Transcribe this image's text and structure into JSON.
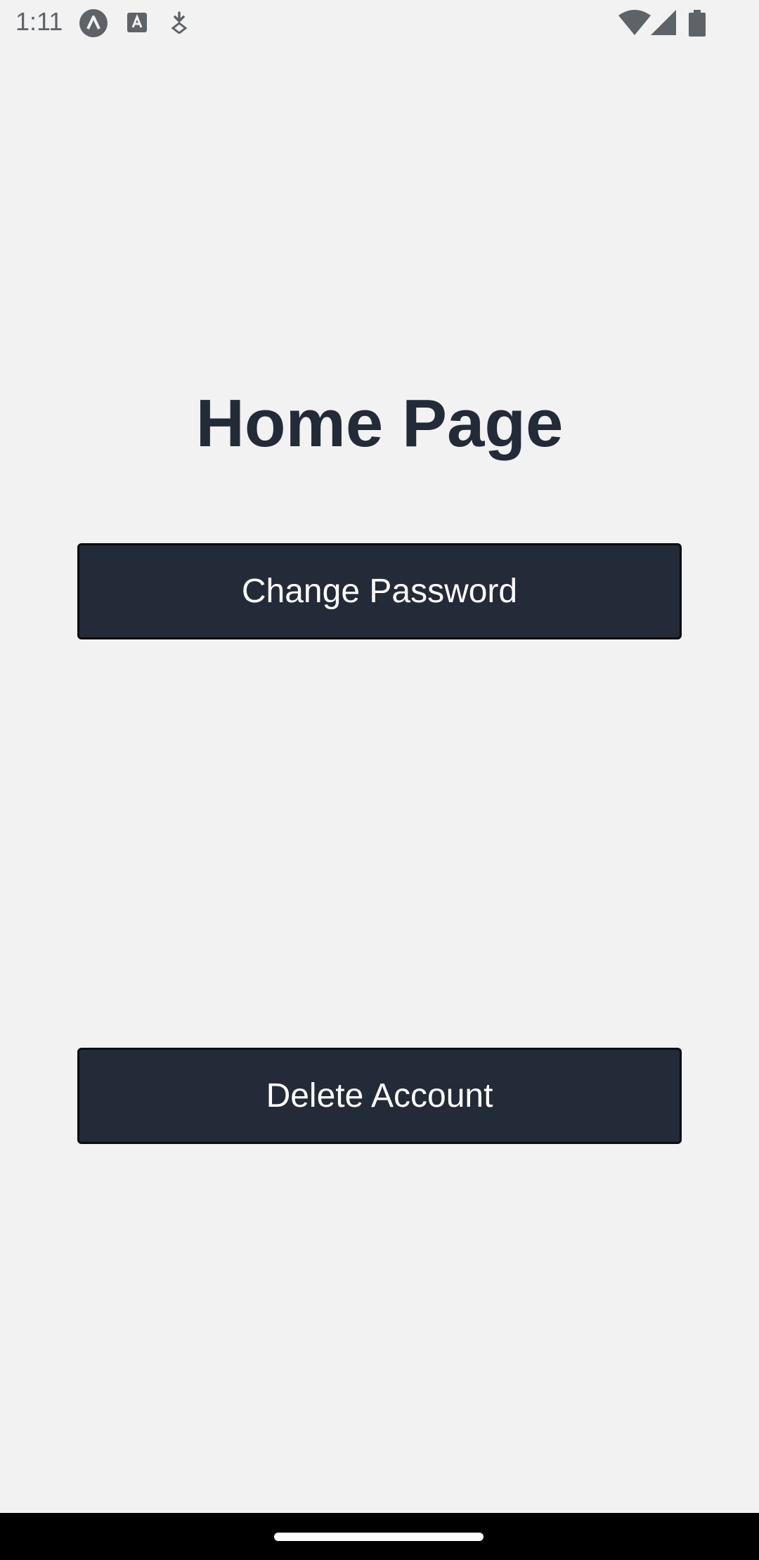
{
  "status_bar": {
    "time": "1:11",
    "left_icons": [
      "app-logo-icon",
      "text-a-icon",
      "download-icon"
    ],
    "right_icons": [
      "wifi-icon",
      "signal-icon",
      "battery-icon"
    ]
  },
  "main": {
    "title": "Home Page",
    "buttons": {
      "change_password": "Change Password",
      "delete_account": "Delete Account"
    }
  },
  "colors": {
    "background": "#f2f2f2",
    "primary": "#232a38",
    "button_text": "#ffffff",
    "nav_bar": "#000000"
  }
}
